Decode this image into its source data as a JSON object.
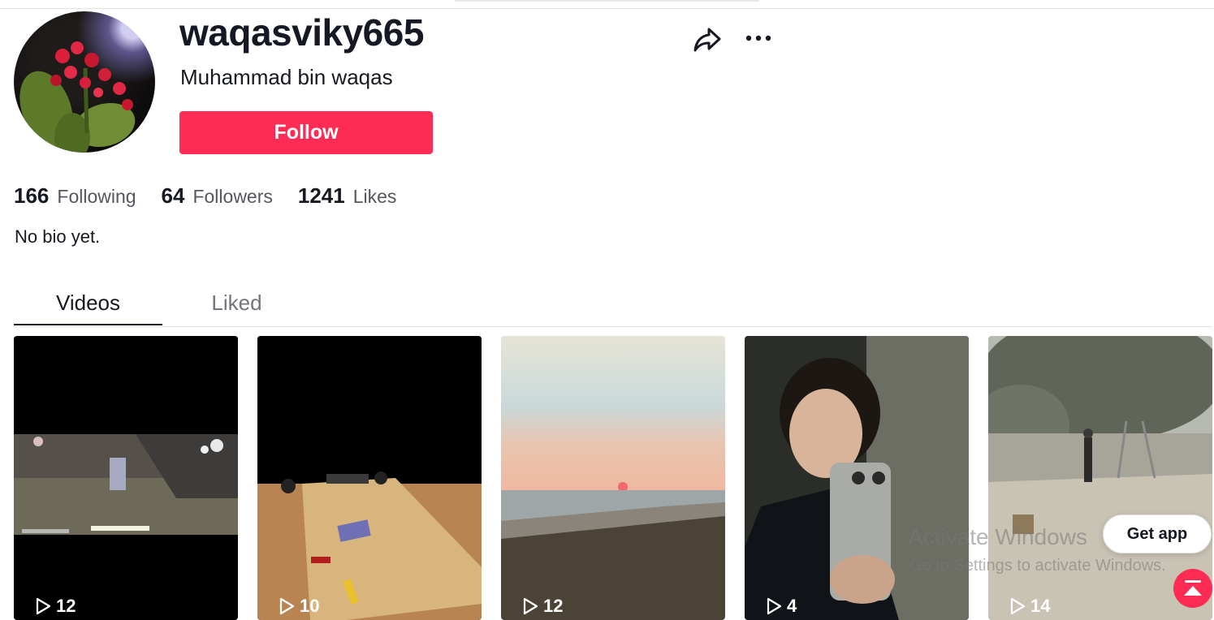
{
  "profile": {
    "username": "waqasviky665",
    "nickname": "Muhammad bin waqas",
    "follow_label": "Follow",
    "bio": "No bio yet."
  },
  "stats": [
    {
      "value": "166",
      "label": "Following"
    },
    {
      "value": "64",
      "label": "Followers"
    },
    {
      "value": "1241",
      "label": "Likes"
    }
  ],
  "tabs": [
    {
      "label": "Videos",
      "active": true
    },
    {
      "label": "Liked",
      "active": false
    }
  ],
  "videos": [
    {
      "views": "12"
    },
    {
      "views": "10"
    },
    {
      "views": "12"
    },
    {
      "views": "4"
    },
    {
      "views": "14"
    }
  ],
  "get_app_label": "Get app",
  "watermark": {
    "title": "Activate Windows",
    "subtitle": "Go to Settings to activate Windows."
  },
  "colors": {
    "accent": "#fe2c55",
    "text": "#161823",
    "secondary_text": "#73747b"
  },
  "icons": {
    "share": "share-arrow-icon",
    "more": "ellipsis-icon",
    "play": "play-outline-icon",
    "scroll_top": "arrow-up-to-top-icon"
  }
}
